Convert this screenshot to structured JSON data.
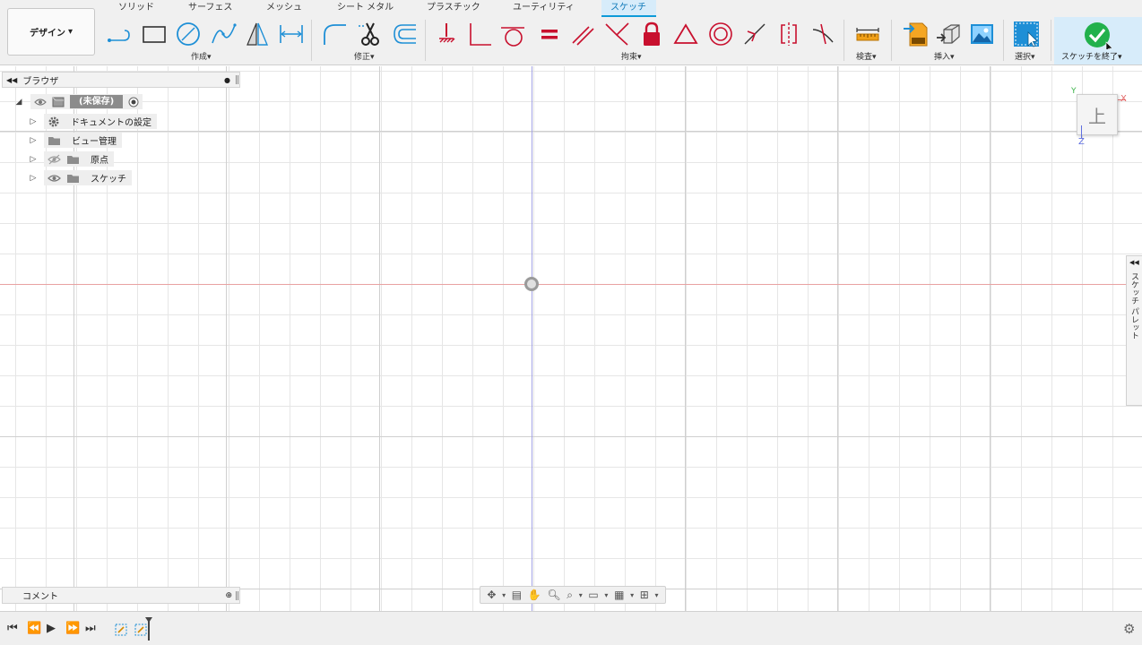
{
  "toolbar": {
    "design_button": "デザイン",
    "tabs": [
      "ソリッド",
      "サーフェス",
      "メッシュ",
      "シート メタル",
      "プラスチック",
      "ユーティリティ",
      "スケッチ"
    ],
    "active_tab": "スケッチ",
    "groups": {
      "create": "作成",
      "modify": "修正",
      "constraints": "拘束",
      "inspect": "検査",
      "insert": "挿入",
      "select": "選択",
      "finish_sketch": "スケッチを終了"
    },
    "dropdown_arrow": "▾",
    "colors": {
      "accent": "#0d9ad8",
      "constraint_red": "#c8102e",
      "finish_green": "#22b14c"
    }
  },
  "browser": {
    "title": "ブラウザ",
    "root": "(未保存)",
    "items": [
      "ドキュメントの設定",
      "ビュー管理",
      "原点",
      "スケッチ"
    ]
  },
  "comments": {
    "title": "コメント"
  },
  "viewcube": {
    "face": "上",
    "axis_x": "X",
    "axis_y": "Y",
    "axis_z": "Z"
  },
  "sketch_palette": {
    "label": "スケッチ パレット"
  }
}
